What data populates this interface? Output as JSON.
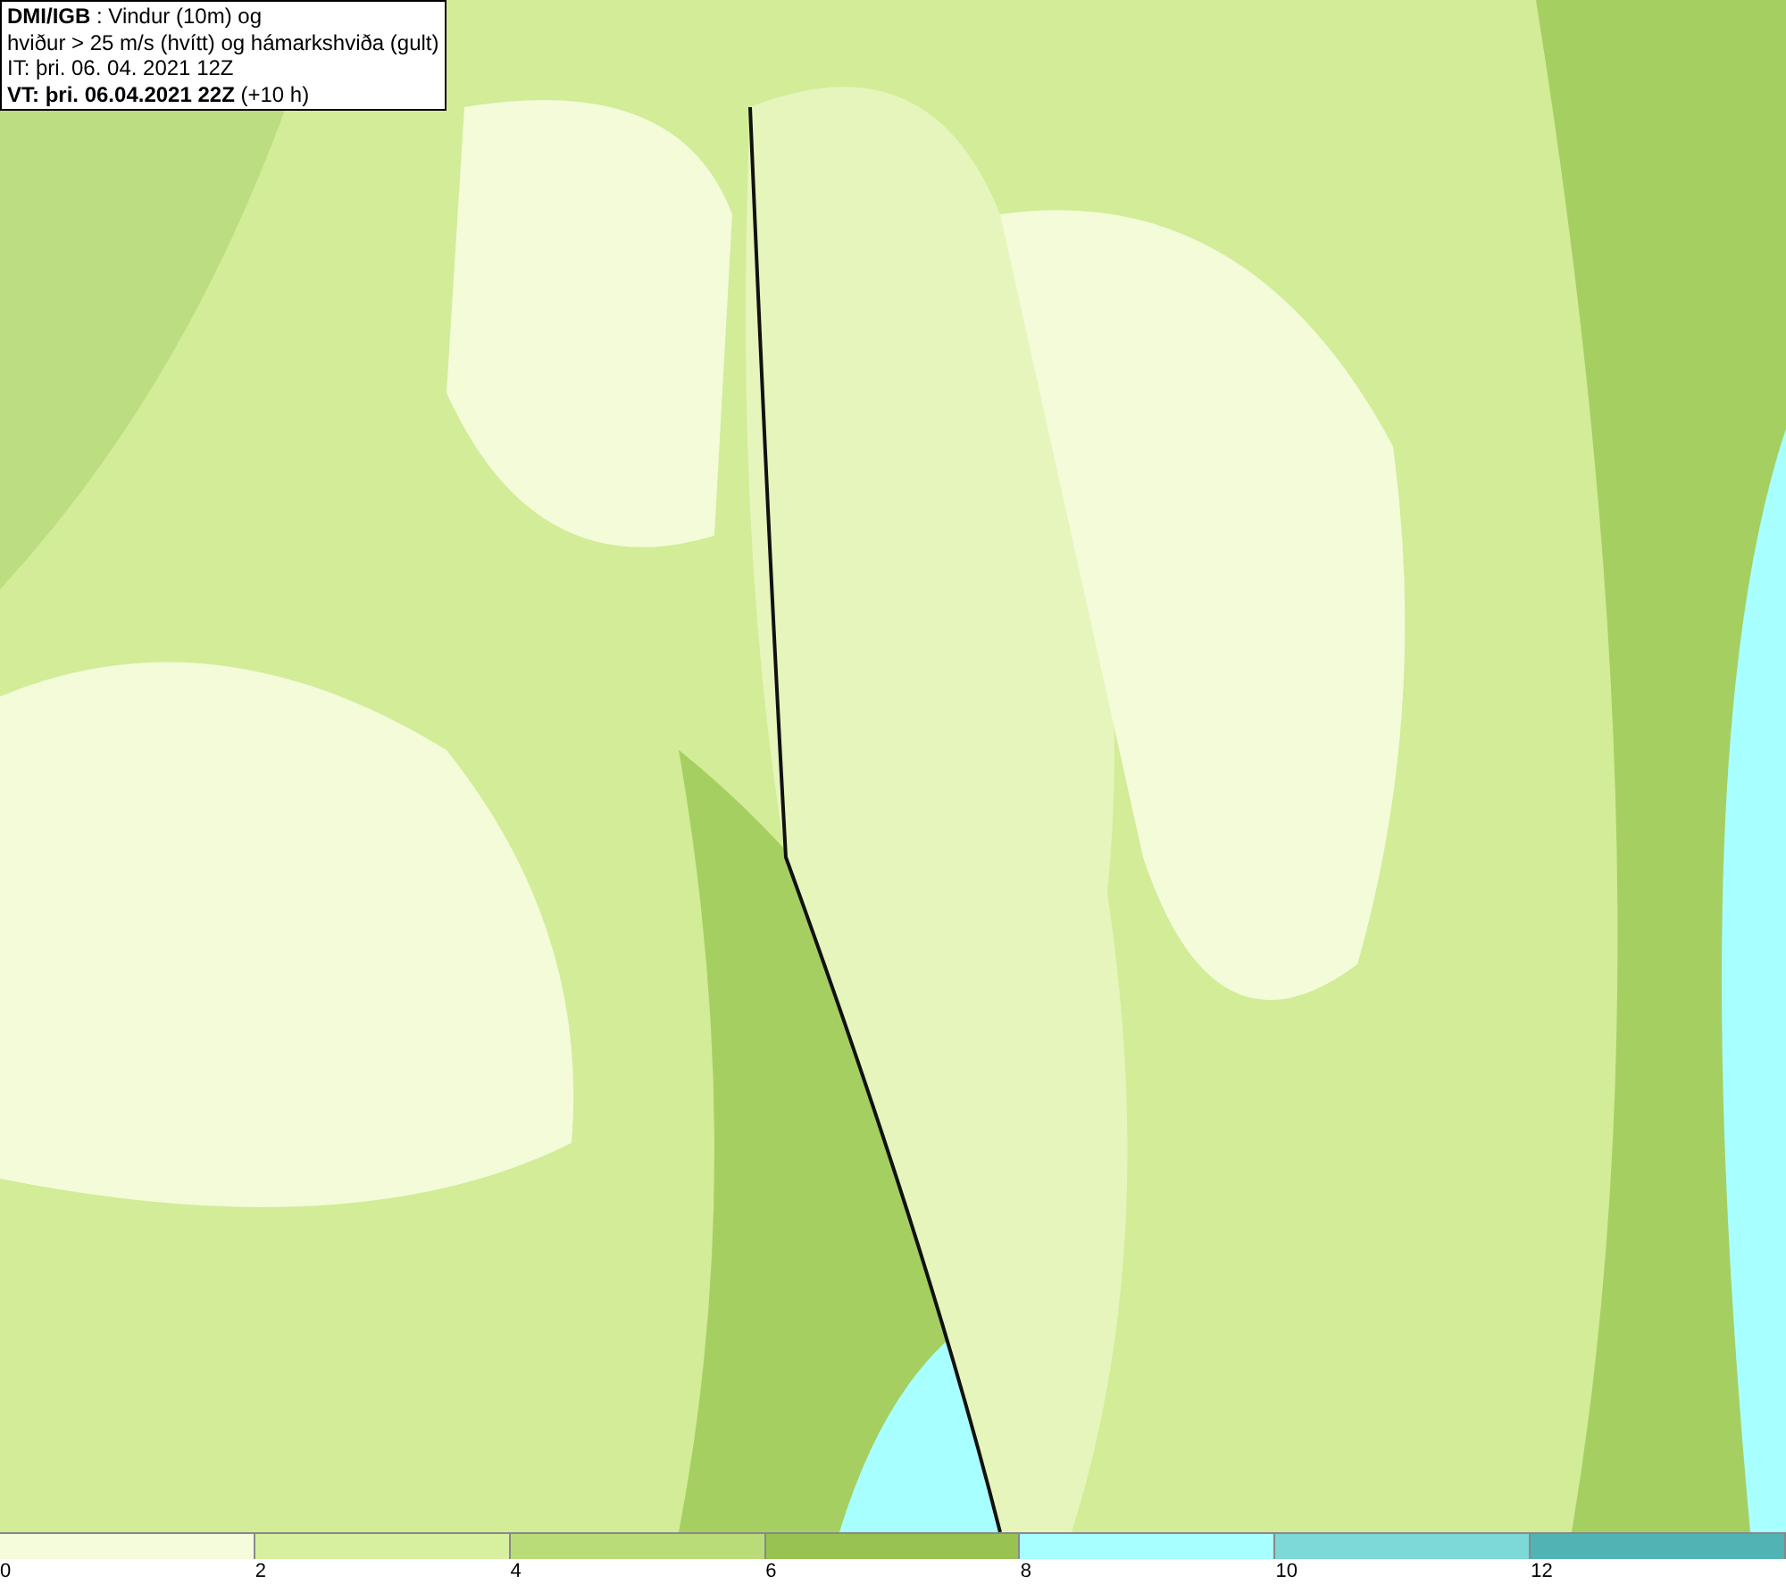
{
  "title_box": {
    "lines": [
      "**DMI/IGB** : Vindur (10m) og",
      "hviður > 25 m/s (hvítt) og hámarkshviða (gult)",
      "IT: þri. 06. 04. 2021 12Z",
      "**VT: þri. 06.04.2021 22Z** (+10 h)"
    ]
  },
  "legend": [
    {
      "label": "0",
      "color": "#f5fcdc"
    },
    {
      "label": "2",
      "color": "#d7f0a0"
    },
    {
      "label": "4",
      "color": "#b9dc78"
    },
    {
      "label": "6",
      "color": "#98c350"
    },
    {
      "label": "8",
      "color": "#a8ffff"
    },
    {
      "label": "10",
      "color": "#7dd8d8"
    },
    {
      "label": "12",
      "color": "#50b4b4"
    }
  ]
}
